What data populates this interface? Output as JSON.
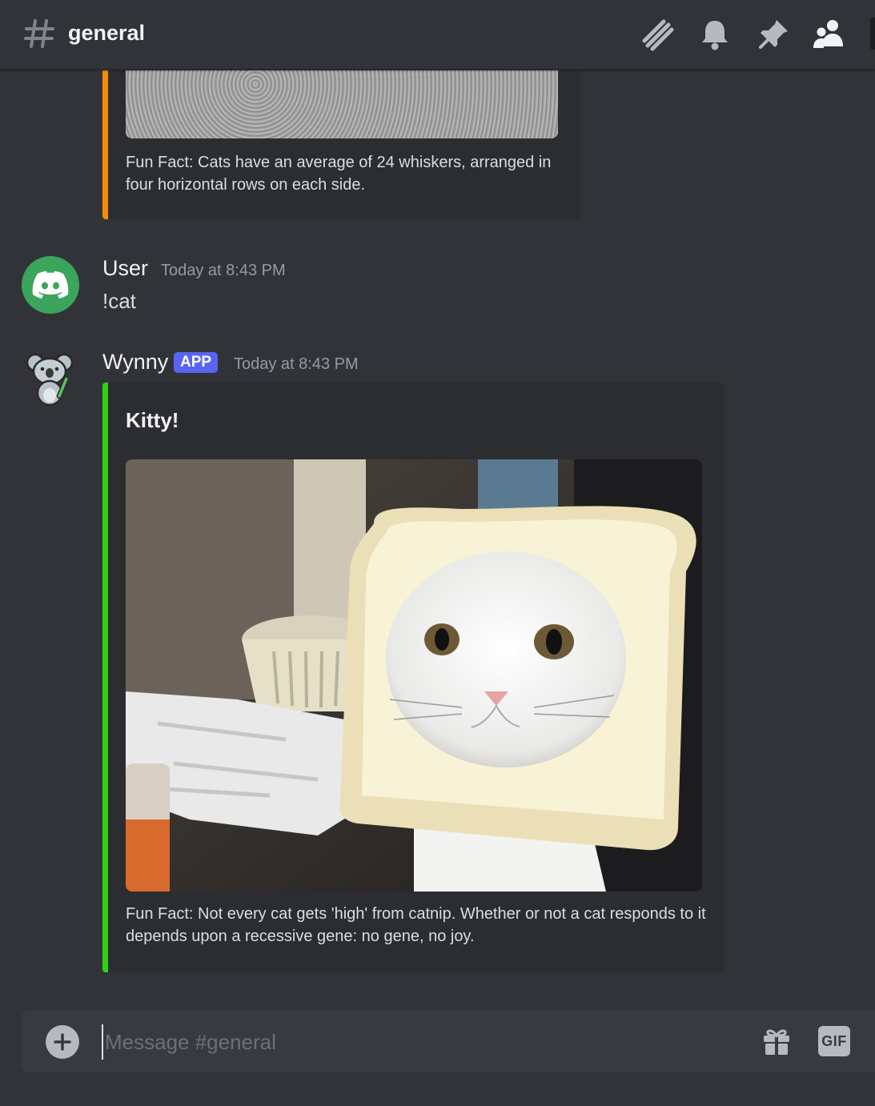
{
  "header": {
    "channel_name": "general",
    "icons": [
      "threads-icon",
      "bell-icon",
      "pin-icon",
      "members-icon"
    ]
  },
  "messages": [
    {
      "type": "embed-continuation",
      "embed": {
        "accent_color": "#f48c06",
        "description": "Fun Fact: Cats have an average of 24 whiskers, arranged in four horizontal rows on each side.",
        "image": "gravel-photo"
      }
    },
    {
      "author": "User",
      "avatar": "discord-logo-avatar",
      "avatar_color": "#3ba55c",
      "timestamp": "Today at 8:43 PM",
      "content": "!cat"
    },
    {
      "author": "Wynny",
      "avatar": "koala-avatar",
      "badge": "APP",
      "timestamp": "Today at 8:43 PM",
      "embed": {
        "accent_color": "#2fd10f",
        "title": "Kitty!",
        "image": "cat-in-bread-photo",
        "description": "Fun Fact: Not every cat gets 'high' from catnip. Whether or not a cat responds to it depends upon a recessive gene: no gene, no joy."
      }
    }
  ],
  "composer": {
    "placeholder": "Message #general",
    "icons": [
      "add-attachment-icon",
      "gift-icon",
      "gif-icon"
    ],
    "gif_label": "GIF"
  }
}
